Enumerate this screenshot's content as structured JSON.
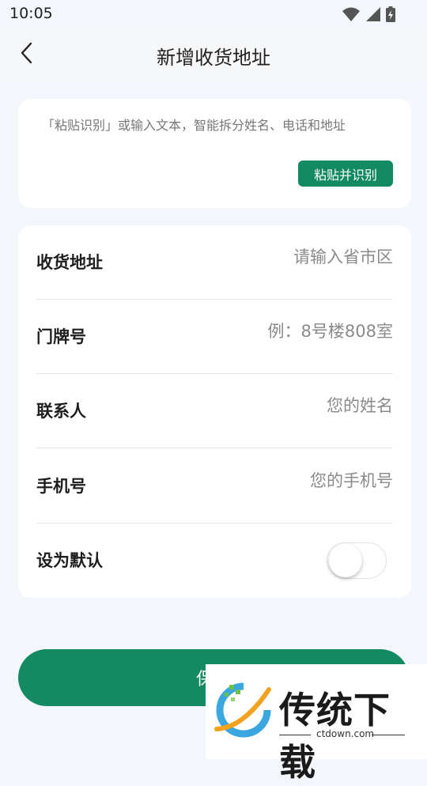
{
  "status_bar": {
    "time": "10:05",
    "icons": [
      "wifi-icon",
      "signal-icon",
      "battery-icon"
    ]
  },
  "header": {
    "title": "新增收货地址",
    "back_icon": "chevron-left-icon"
  },
  "paste_card": {
    "hint": "「粘贴识别」或输入文本，智能拆分姓名、电话和地址",
    "button_label": "粘贴并识别"
  },
  "form": {
    "address": {
      "label": "收货地址",
      "placeholder": "请输入省市区",
      "value": ""
    },
    "house_number": {
      "label": "门牌号",
      "placeholder": "例：8号楼808室",
      "value": ""
    },
    "contact": {
      "label": "联系人",
      "placeholder": "您的姓名",
      "value": ""
    },
    "phone": {
      "label": "手机号",
      "placeholder": "您的手机号",
      "value": ""
    },
    "default": {
      "label": "设为默认",
      "enabled": false
    }
  },
  "save_button": {
    "label": "保存"
  },
  "watermark": {
    "brand": "传统下载",
    "domain": "ctdown.com"
  },
  "colors": {
    "accent": "#138a62",
    "background": "#f3f6fa",
    "card": "#ffffff",
    "placeholder": "#8a8a8a"
  }
}
